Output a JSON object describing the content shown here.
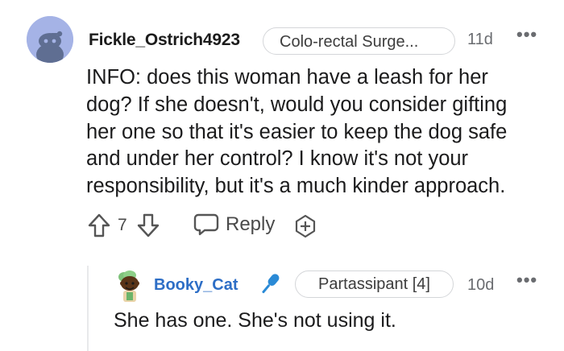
{
  "comment": {
    "username": "Fickle_Ostrich4923",
    "flair": "Colo-rectal Surge...",
    "time": "11d",
    "more": "•••",
    "avatar_icon": "snoo-avatar-icon",
    "lines": [
      "INFO: does this woman have a leash for her",
      "dog? If she doesn't, would you consider gifting",
      "her one so that it's easier to keep the dog safe",
      "and under her control? I know it's not your",
      "responsibility, but it's a much kinder approach."
    ],
    "votes": "7",
    "reply_label": "Reply"
  },
  "reply": {
    "username": "Booky_Cat",
    "flair": "Partassipant [4]",
    "time": "10d",
    "more": "•••",
    "avatar_icon": "custom-avatar-icon",
    "text": "She has one. She's not using it."
  },
  "colors": {
    "avatar_bg": "#a5b3e6",
    "reply_username": "#2d6ec6",
    "mic_icon": "#2a8ad6"
  }
}
